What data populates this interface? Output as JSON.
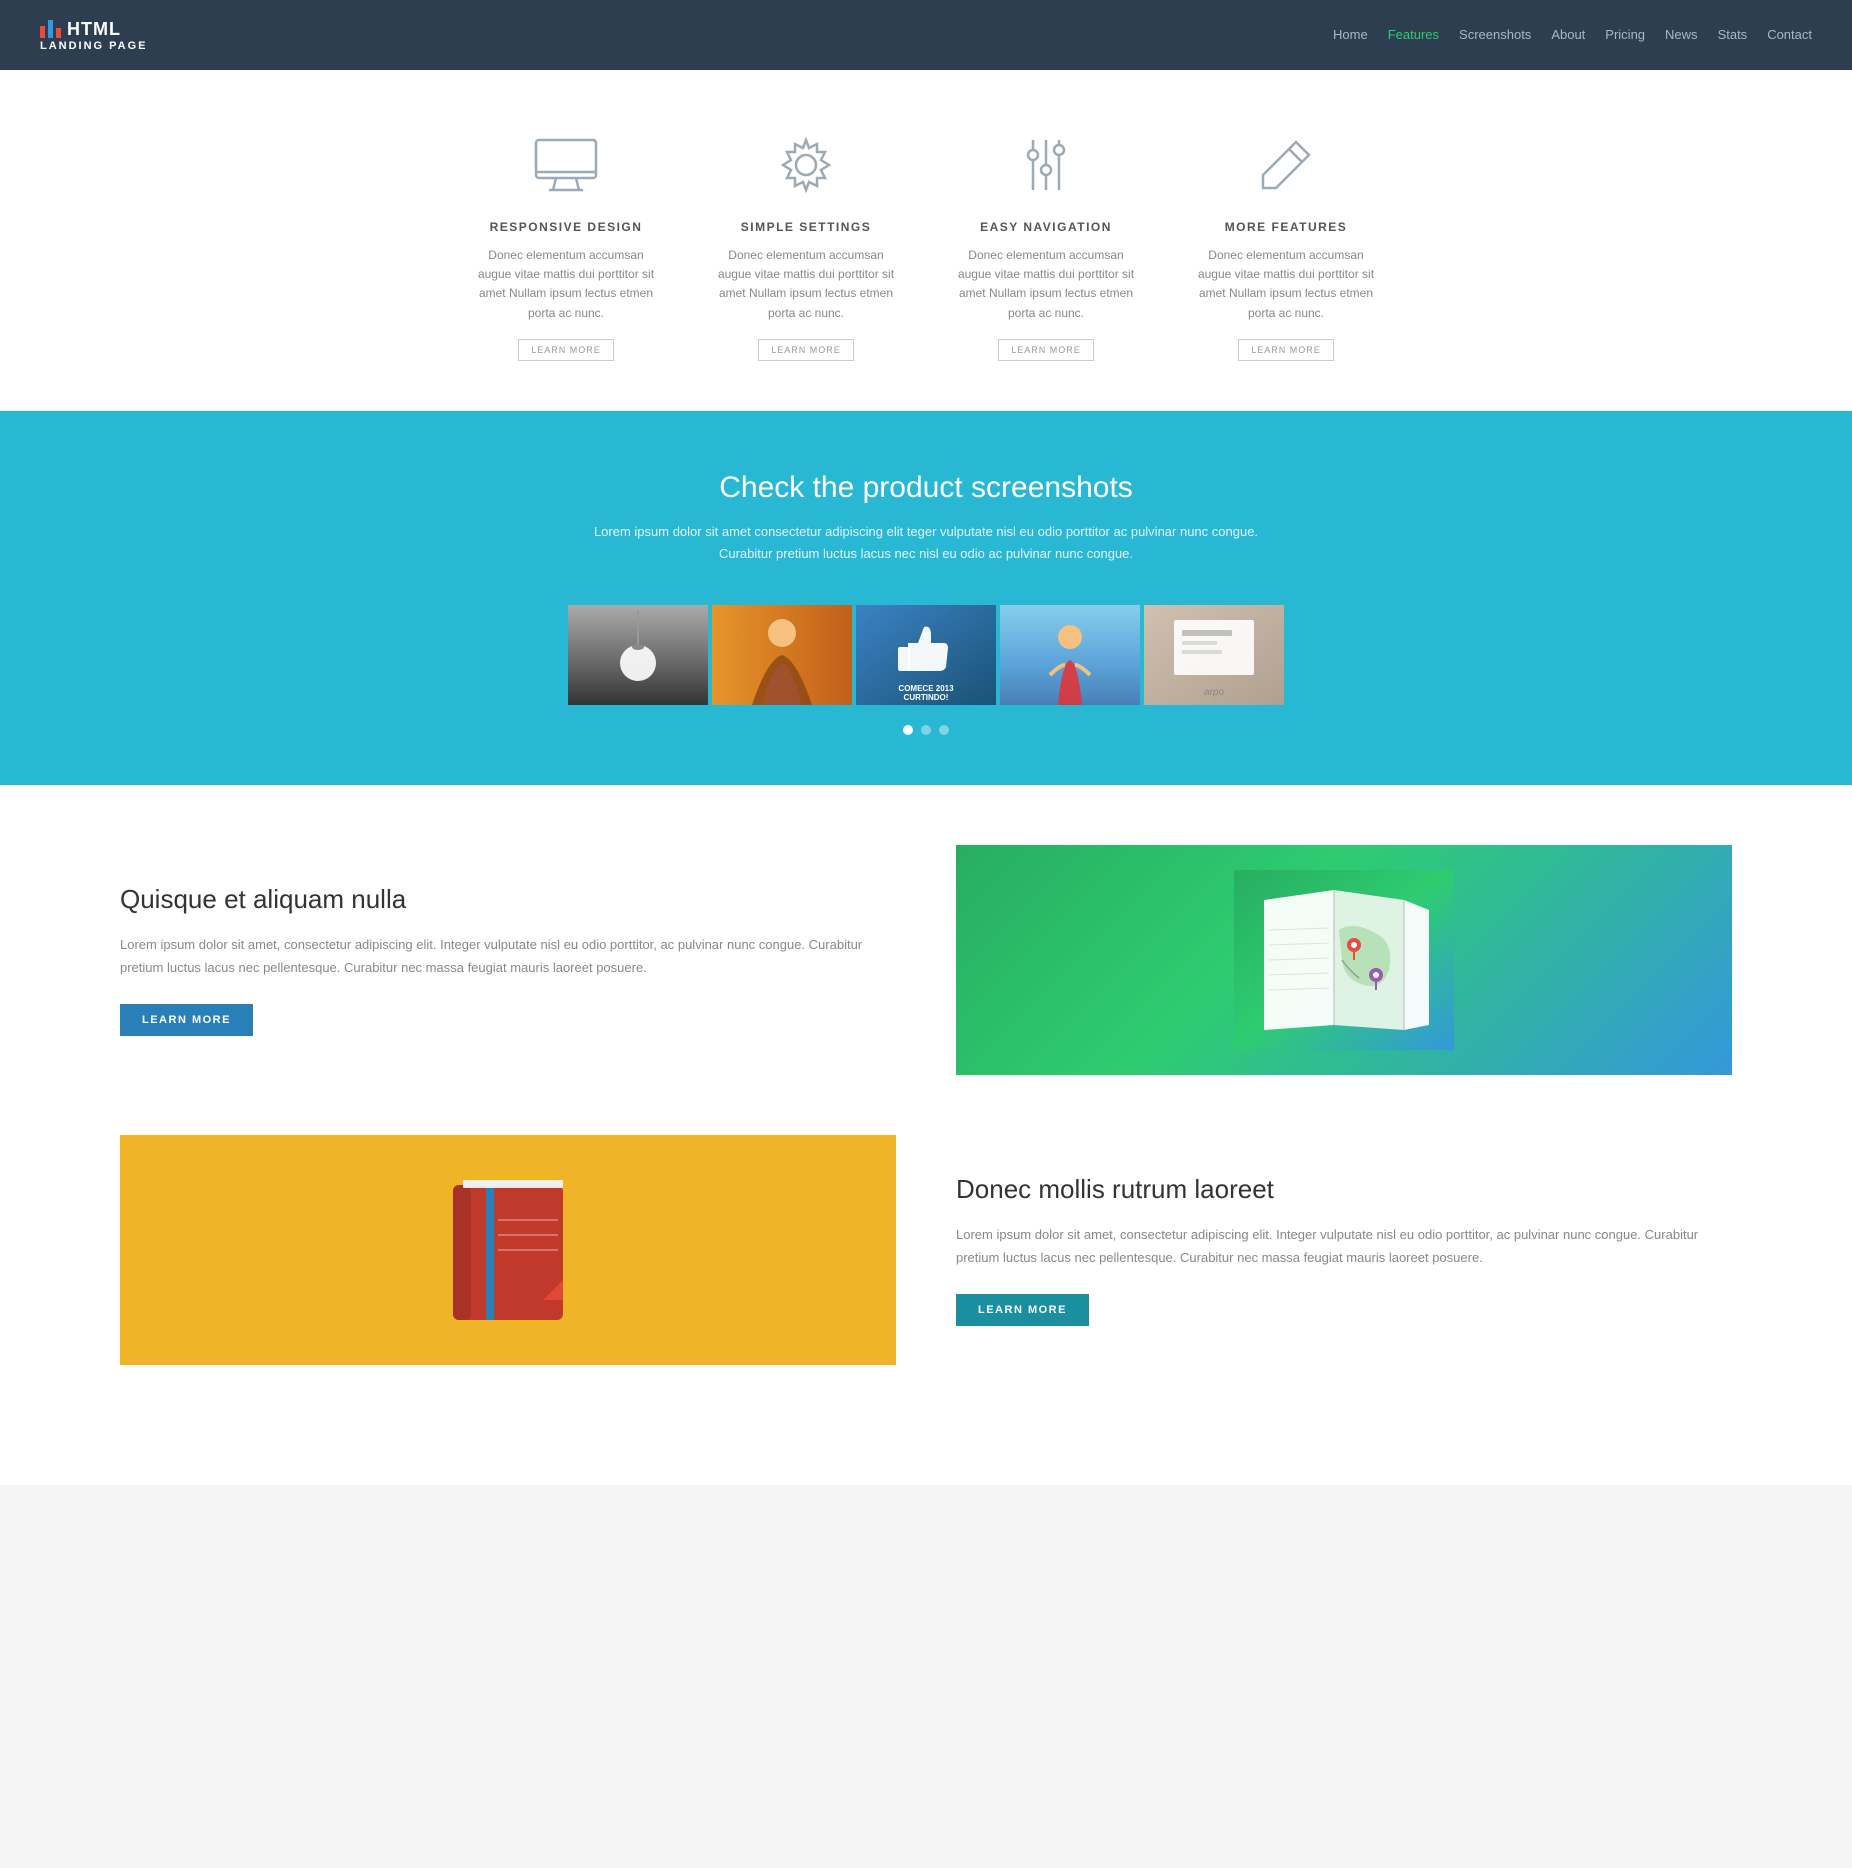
{
  "brand": {
    "name": "HTML",
    "subtitle": "LANDING PAGE"
  },
  "nav": {
    "links": [
      {
        "label": "Home",
        "active": false
      },
      {
        "label": "Features",
        "active": true
      },
      {
        "label": "Screenshots",
        "active": false
      },
      {
        "label": "About",
        "active": false
      },
      {
        "label": "Pricing",
        "active": false
      },
      {
        "label": "News",
        "active": false
      },
      {
        "label": "Stats",
        "active": false
      },
      {
        "label": "Contact",
        "active": false
      }
    ]
  },
  "features": {
    "items": [
      {
        "id": "responsive",
        "title": "RESPONSIVE DESIGN",
        "text": "Donec elementum accumsan augue vitae mattis dui porttitor sit amet Nullam ipsum lectus etmen porta ac nunc.",
        "btn": "LEARN MORE"
      },
      {
        "id": "settings",
        "title": "SIMPLE SETTINGS",
        "text": "Donec elementum accumsan augue vitae mattis dui porttitor sit amet Nullam ipsum lectus etmen porta ac nunc.",
        "btn": "LEARN MORE"
      },
      {
        "id": "navigation",
        "title": "EASY NAVIGATION",
        "text": "Donec elementum accumsan augue vitae mattis dui porttitor sit amet Nullam ipsum lectus etmen porta ac nunc.",
        "btn": "LEARN MORE"
      },
      {
        "id": "more",
        "title": "MORE FEATURES",
        "text": "Donec elementum accumsan augue vitae mattis dui porttitor sit amet Nullam ipsum lectus etmen porta ac nunc.",
        "btn": "LEARN MORE"
      }
    ]
  },
  "screenshots": {
    "title": "Check the product screenshots",
    "subtitle_line1": "Lorem ipsum dolor sit amet consectetur adipiscing elit teger vulputate nisl eu odio porttitor ac pulvinar nunc congue.",
    "subtitle_line2": "Curabitur pretium luctus lacus nec nisl eu odio ac pulvinar nunc congue.",
    "gallery_items": [
      {
        "id": "thumb1",
        "label": "Golf"
      },
      {
        "id": "thumb2",
        "label": "Person"
      },
      {
        "id": "thumb3",
        "label": "Like"
      },
      {
        "id": "thumb4",
        "label": "Girl"
      },
      {
        "id": "thumb5",
        "label": "Card"
      }
    ],
    "dots": [
      {
        "active": true
      },
      {
        "active": false
      },
      {
        "active": false
      }
    ]
  },
  "about": {
    "section1": {
      "title": "Quisque et aliquam nulla",
      "text": "Lorem ipsum dolor sit amet, consectetur adipiscing elit. Integer vulputate nisl eu odio porttitor, ac pulvinar nunc congue. Curabitur pretium luctus lacus nec pellentesque. Curabitur nec massa feugiat mauris laoreet posuere.",
      "btn": "LEARN MORE"
    },
    "section2": {
      "title": "Donec mollis rutrum laoreet",
      "text": "Lorem ipsum dolor sit amet, consectetur adipiscing elit. Integer vulputate nisl eu odio porttitor, ac pulvinar nunc congue. Curabitur pretium luctus lacus nec pellentesque. Curabitur nec massa feugiat mauris laoreet posuere.",
      "btn": "LEARN MORE"
    }
  },
  "colors": {
    "nav_bg": "#2c3e50",
    "screenshots_bg": "#29b8d4",
    "accent_blue": "#2980b9",
    "accent_teal": "#1a8fa0",
    "active_nav": "#2ecc71"
  }
}
